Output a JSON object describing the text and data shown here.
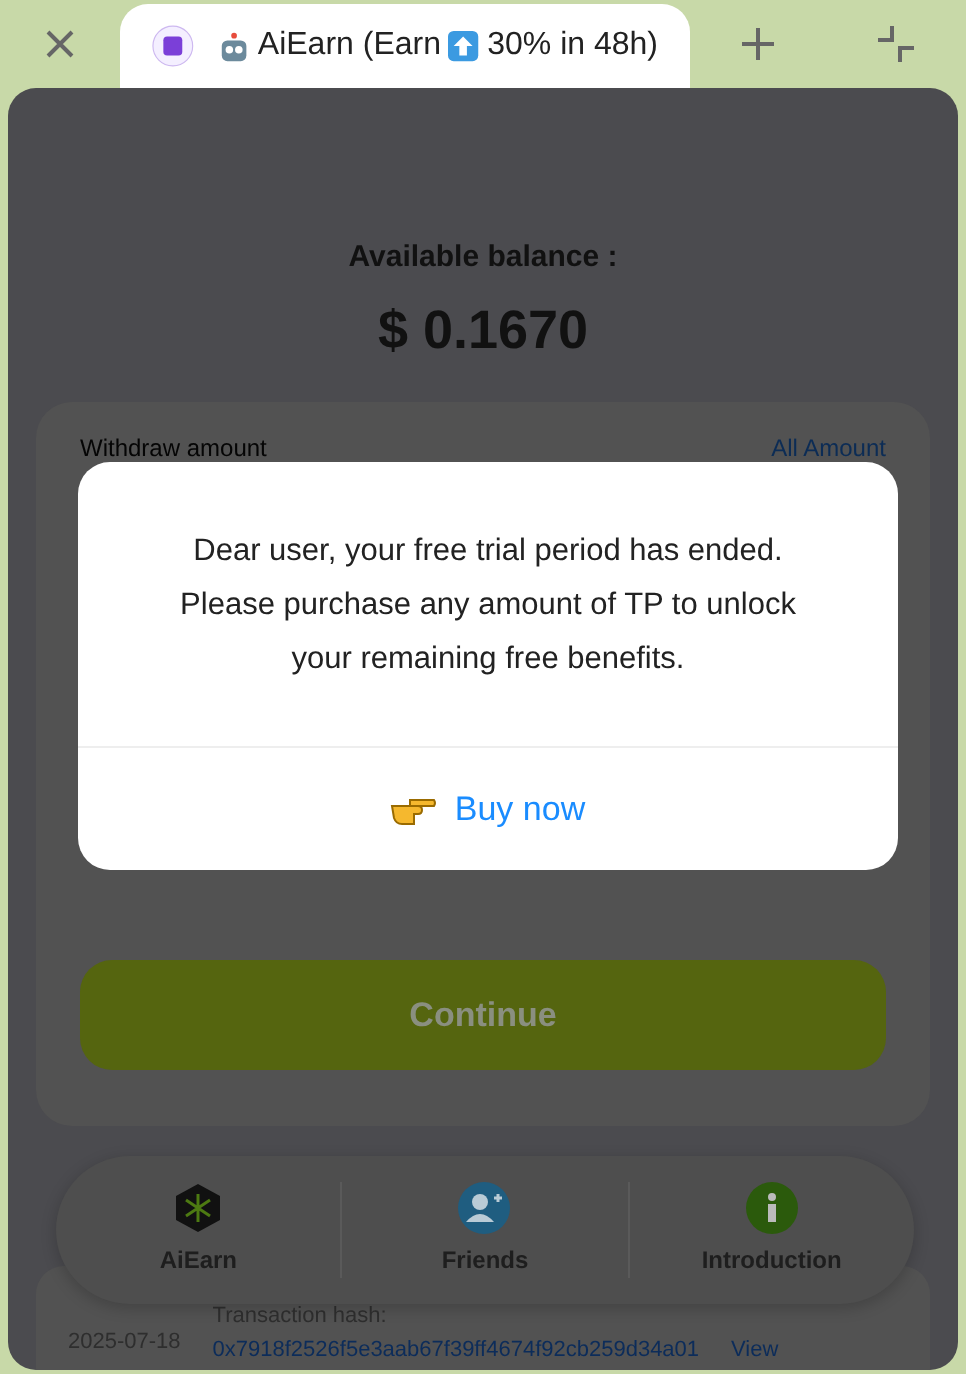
{
  "browser": {
    "tab_title_before": "AiEarn (Earn",
    "tab_title_after": "30% in 48h)"
  },
  "balance": {
    "label": "Available balance :",
    "amount": "$ 0.1670"
  },
  "withdraw": {
    "label": "Withdraw amount",
    "all_link": "All Amount",
    "continue_button": "Continue"
  },
  "modal": {
    "message": "Dear user, your free trial period has ended. Please purchase any amount of TP to unlock your remaining free benefits.",
    "action": "Buy now"
  },
  "nav": [
    {
      "label": "AiEarn",
      "kind": "network"
    },
    {
      "label": "Friends",
      "kind": "friends"
    },
    {
      "label": "Introduction",
      "kind": "info"
    }
  ],
  "transaction": {
    "date": "2025-07-18",
    "hash_label": "Transaction hash:",
    "hash": "0x7918f2526f5e3aab67f39ff4674f92cb259d34a01",
    "view": "View"
  }
}
